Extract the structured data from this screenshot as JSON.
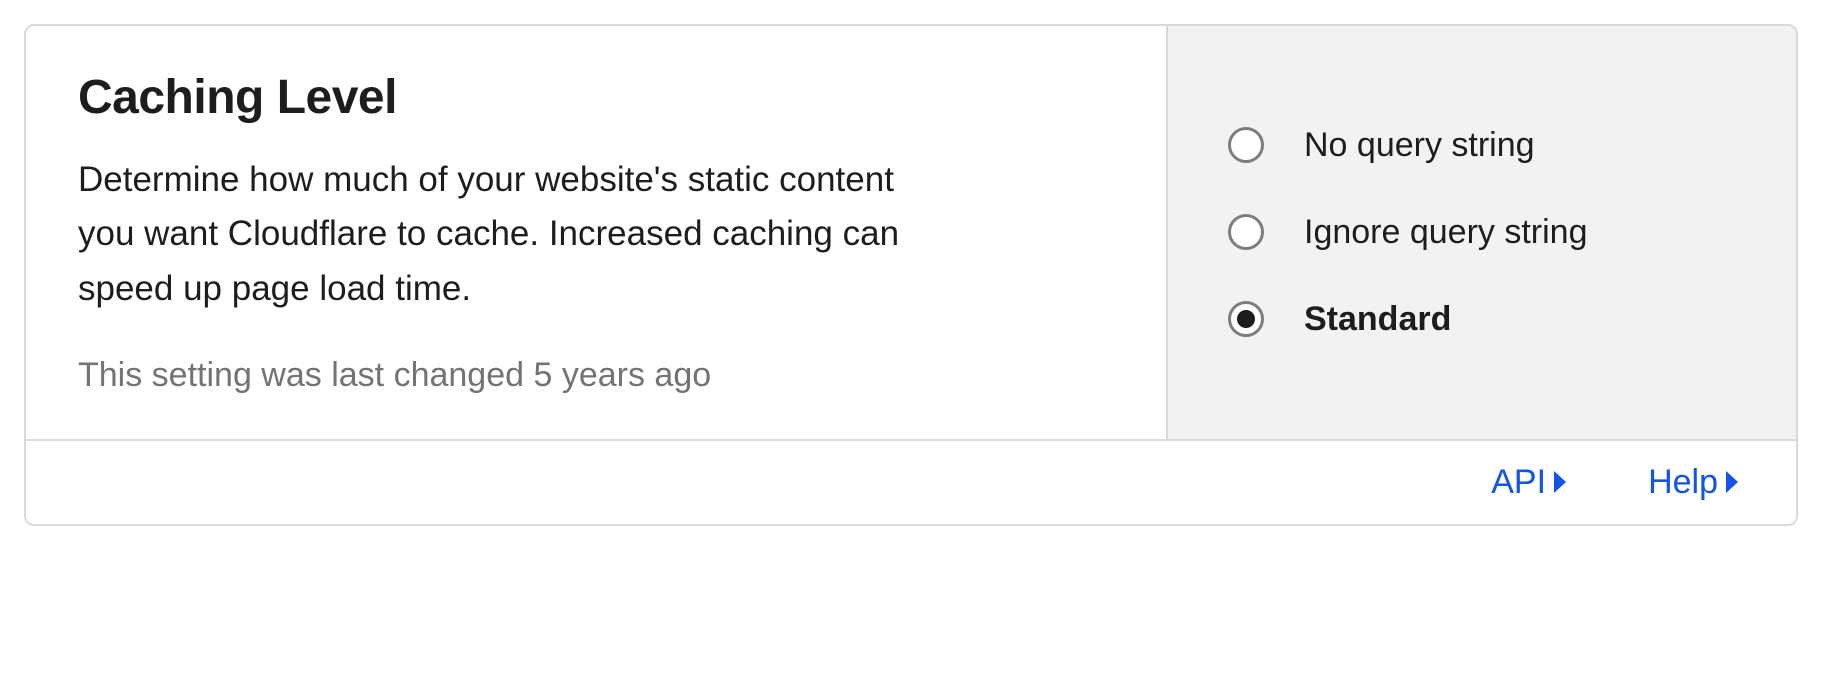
{
  "card": {
    "title": "Caching Level",
    "description": "Determine how much of your website's static content you want Cloudflare to cache. Increased caching can speed up page load time.",
    "last_changed": "This setting was last changed 5 years ago",
    "options": [
      {
        "label": "No query string",
        "selected": false
      },
      {
        "label": "Ignore query string",
        "selected": false
      },
      {
        "label": "Standard",
        "selected": true
      }
    ],
    "footer": {
      "api_label": "API",
      "help_label": "Help"
    }
  }
}
